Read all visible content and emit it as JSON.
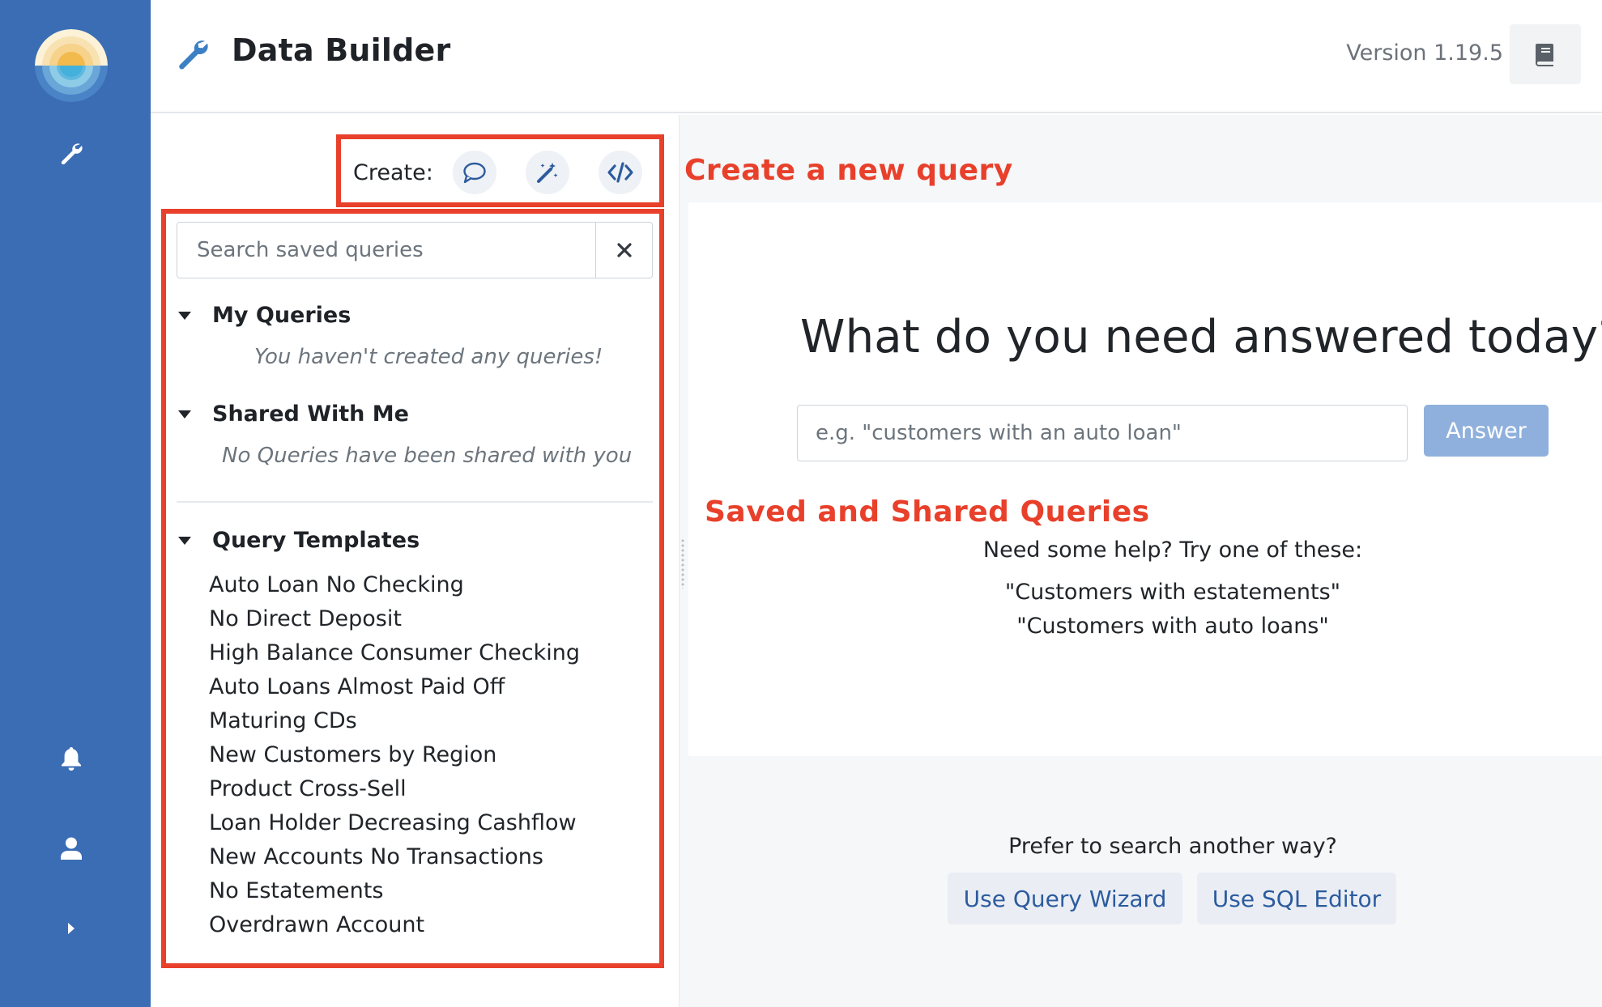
{
  "app": {
    "title": "Data Builder",
    "version": "Version 1.19.5"
  },
  "nav": {
    "items": [
      {
        "name": "wrench-icon",
        "label": "Data Builder"
      },
      {
        "name": "bell-icon",
        "label": "Notifications"
      },
      {
        "name": "user-icon",
        "label": "Profile"
      },
      {
        "name": "chevron-right-icon",
        "label": "Expand"
      }
    ]
  },
  "create": {
    "label": "Create:",
    "buttons": [
      "chat-bubble-icon",
      "magic-wand-icon",
      "code-icon"
    ]
  },
  "search": {
    "placeholder": "Search saved queries",
    "value": ""
  },
  "sections": {
    "my_queries": {
      "title": "My Queries",
      "empty": "You haven't created any queries!"
    },
    "shared": {
      "title": "Shared With Me",
      "empty": "No Queries have been shared with you"
    },
    "templates": {
      "title": "Query Templates",
      "items": [
        "Auto Loan No Checking",
        "No Direct Deposit",
        "High Balance Consumer Checking",
        "Auto Loans Almost Paid Off",
        "Maturing CDs",
        "New Customers by Region",
        "Product Cross-Sell",
        "Loan Holder Decreasing Cashflow",
        "New Accounts No Transactions",
        "No Estatements",
        "Overdrawn Account"
      ]
    }
  },
  "annotations": {
    "create": "Create a new query",
    "saved": "Saved and Shared Queries",
    "color": "#e8402b"
  },
  "main": {
    "headline": "What do you need answered today?",
    "input_placeholder": "e.g. \"customers with an auto loan\"",
    "input_value": "",
    "answer_label": "Answer",
    "help": "Need some help? Try one of these:",
    "examples": [
      "\"Customers with estatements\"",
      "\"Customers with auto loans\""
    ],
    "alt_prompt": "Prefer to search another way?",
    "wizard_label": "Use Query Wizard",
    "sql_label": "Use SQL Editor"
  },
  "colors": {
    "nav": "#3b6db5",
    "accent": "#2c5b9e",
    "answer_button": "#8fb0dc"
  }
}
